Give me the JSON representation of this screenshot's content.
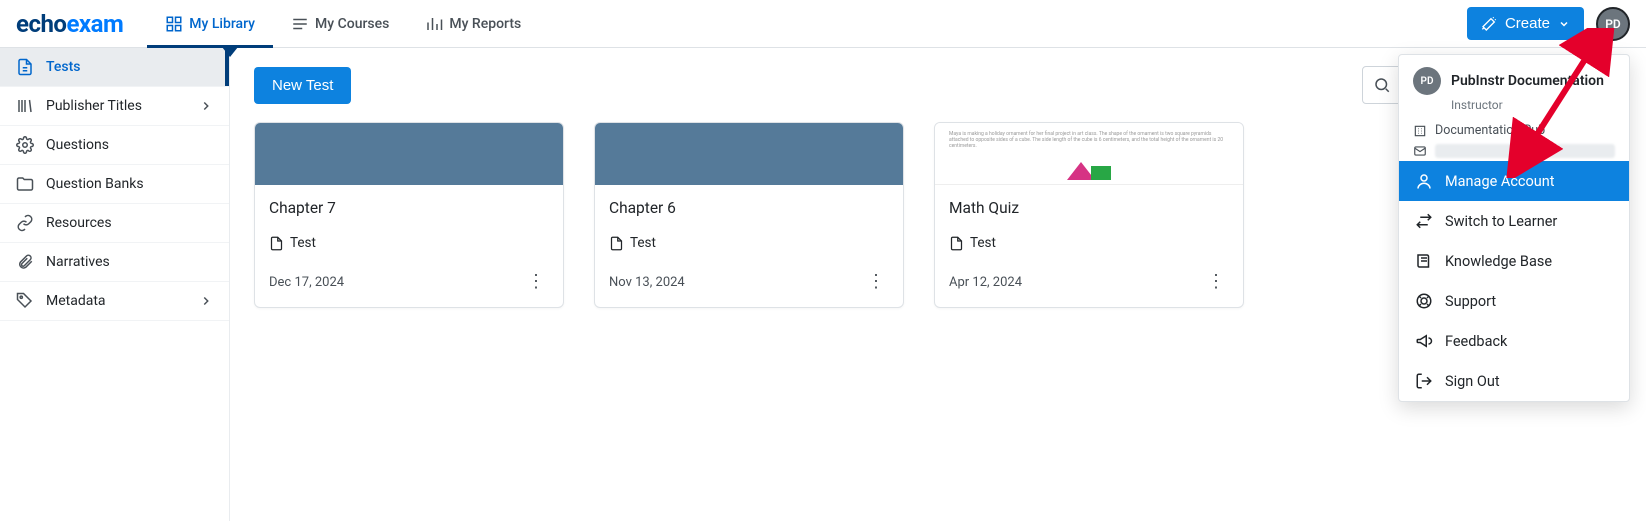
{
  "logo": {
    "part1": "echo",
    "part2": "exam"
  },
  "nav": [
    {
      "label": "My Library",
      "active": true
    },
    {
      "label": "My Courses",
      "active": false
    },
    {
      "label": "My Reports",
      "active": false
    }
  ],
  "create_label": "Create",
  "avatar_initials": "PD",
  "sidebar": [
    {
      "label": "Tests",
      "icon": "file",
      "active": true,
      "chevron": false
    },
    {
      "label": "Publisher Titles",
      "icon": "books",
      "active": false,
      "chevron": true
    },
    {
      "label": "Questions",
      "icon": "gear",
      "active": false,
      "chevron": false
    },
    {
      "label": "Question Banks",
      "icon": "folder",
      "active": false,
      "chevron": false
    },
    {
      "label": "Resources",
      "icon": "link",
      "active": false,
      "chevron": false
    },
    {
      "label": "Narratives",
      "icon": "clip",
      "active": false,
      "chevron": false
    },
    {
      "label": "Metadata",
      "icon": "tag",
      "active": false,
      "chevron": true
    }
  ],
  "new_test_label": "New Test",
  "search_placeholder": "Search",
  "cards": [
    {
      "title": "Chapter 7",
      "type": "Test",
      "date": "Dec 17, 2024",
      "thumb": "blue"
    },
    {
      "title": "Chapter 6",
      "type": "Test",
      "date": "Nov 13, 2024",
      "thumb": "blue"
    },
    {
      "title": "Math Quiz",
      "type": "Test",
      "date": "Apr 12, 2024",
      "thumb": "doc"
    }
  ],
  "profile": {
    "initials": "PD",
    "name": "PubInstr Documentation",
    "role": "Instructor",
    "org": "Documentation Pub",
    "menu": [
      {
        "label": "Manage Account",
        "icon": "person",
        "hover": true
      },
      {
        "label": "Switch to Learner",
        "icon": "swap",
        "hover": false
      },
      {
        "label": "Knowledge Base",
        "icon": "book",
        "hover": false
      },
      {
        "label": "Support",
        "icon": "help",
        "hover": false
      },
      {
        "label": "Feedback",
        "icon": "mega",
        "hover": false
      },
      {
        "label": "Sign Out",
        "icon": "signout",
        "hover": false
      }
    ]
  }
}
